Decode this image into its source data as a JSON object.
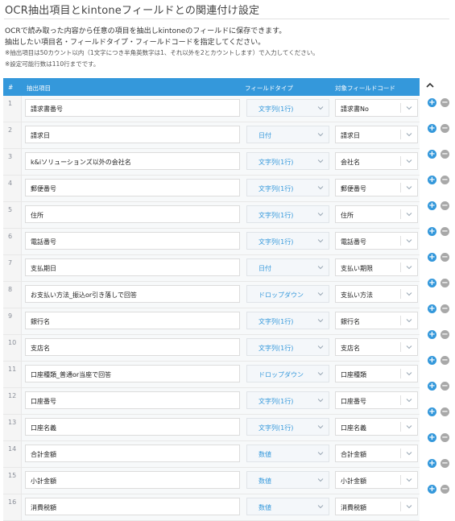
{
  "title": "OCR抽出項目とkintoneフィールドとの関連付け設定",
  "description": [
    "OCRで読み取った内容から任意の項目を抽出しkintoneのフィールドに保存できます。",
    "抽出したい項目名・フィールドタイプ・フィールドコードを指定してください。"
  ],
  "notes": [
    "※抽出項目は50カウント以内（1文字につき半角英数字は1、それ以外を2とカウントします）で入力してください。",
    "※設定可能行数は110行までです。"
  ],
  "table": {
    "headers": {
      "num": "#",
      "name": "抽出項目",
      "type": "フィールドタイプ",
      "code": "対象フィールドコード"
    },
    "rows": [
      {
        "num": "1",
        "name": "請求書番号",
        "type": "文字列(1行)",
        "code": "請求書No"
      },
      {
        "num": "2",
        "name": "請求日",
        "type": "日付",
        "code": "請求日"
      },
      {
        "num": "3",
        "name": "k&iソリューションズ以外の会社名",
        "type": "文字列(1行)",
        "code": "会社名"
      },
      {
        "num": "4",
        "name": "郵便番号",
        "type": "文字列(1行)",
        "code": "郵便番号"
      },
      {
        "num": "5",
        "name": "住所",
        "type": "文字列(1行)",
        "code": "住所"
      },
      {
        "num": "6",
        "name": "電話番号",
        "type": "文字列(1行)",
        "code": "電話番号"
      },
      {
        "num": "7",
        "name": "支払期日",
        "type": "日付",
        "code": "支払い期限"
      },
      {
        "num": "8",
        "name": "お支払い方法_振込or引き落しで回答",
        "type": "ドロップダウン",
        "code": "支払い方法"
      },
      {
        "num": "9",
        "name": "銀行名",
        "type": "文字列(1行)",
        "code": "銀行名"
      },
      {
        "num": "10",
        "name": "支店名",
        "type": "文字列(1行)",
        "code": "支店名"
      },
      {
        "num": "11",
        "name": "口座種類_普通or当座で回答",
        "type": "ドロップダウン",
        "code": "口座種類"
      },
      {
        "num": "12",
        "name": "口座番号",
        "type": "文字列(1行)",
        "code": "口座番号"
      },
      {
        "num": "13",
        "name": "口座名義",
        "type": "文字列(1行)",
        "code": "口座名義"
      },
      {
        "num": "14",
        "name": "合計金額",
        "type": "数値",
        "code": "合計金額"
      },
      {
        "num": "15",
        "name": "小計金額",
        "type": "数値",
        "code": "小計金額"
      },
      {
        "num": "16",
        "name": "消費税額",
        "type": "数値",
        "code": "消費税額"
      }
    ]
  },
  "icons": {
    "add": "plus-circle-icon",
    "remove": "minus-circle-icon",
    "dropdown": "chevron-down-icon",
    "collapse": "chevron-up-icon"
  },
  "colors": {
    "accent": "#3498db",
    "remove": "#a8a8a8"
  }
}
